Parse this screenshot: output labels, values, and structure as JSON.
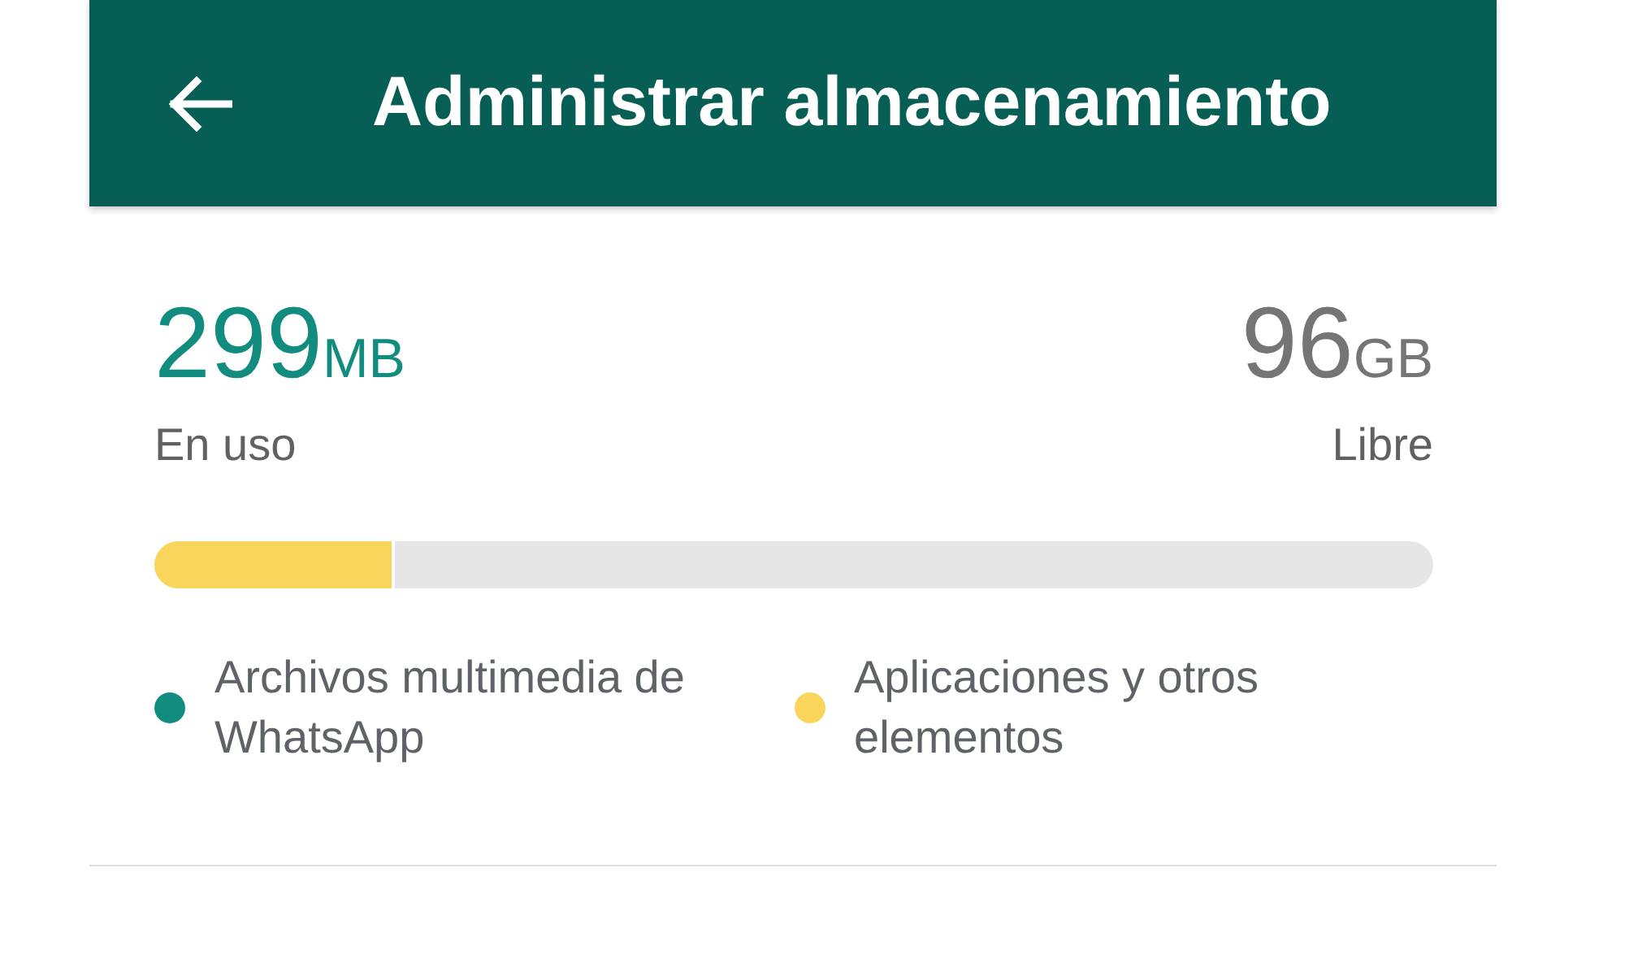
{
  "header": {
    "title": "Administrar almacenamiento"
  },
  "used": {
    "value": "299",
    "unit": "MB",
    "label": "En uso"
  },
  "free": {
    "value": "96",
    "unit": "GB",
    "label": "Libre"
  },
  "storage_bar": {
    "level": 0.186
  },
  "legend": [
    {
      "label": "Archivos multimedia de WhatsApp",
      "color": "#128c7e"
    },
    {
      "label": "Aplicaciones y otros elementos",
      "color": "#fad55c"
    }
  ]
}
